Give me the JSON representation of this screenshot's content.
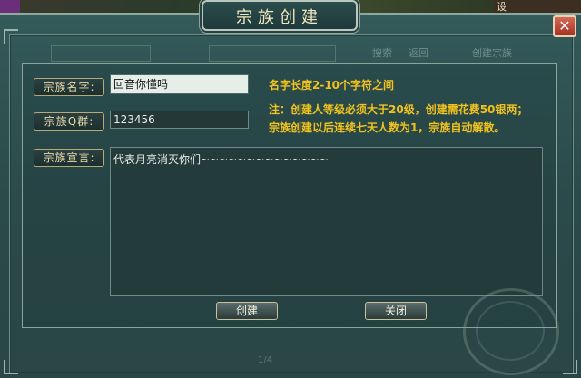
{
  "scene": {
    "top_right_text": "设"
  },
  "dialog": {
    "title": "宗族创建",
    "close_symbol": "✕",
    "ghost_tabs": [
      "",
      "",
      "搜索",
      "返回",
      "创建宗族"
    ],
    "fields": {
      "name_label": "宗族名字:",
      "name_value": "回音你懂吗",
      "qq_label": "宗族Q群:",
      "qq_value": "123456",
      "declaration_label": "宗族宣言:",
      "declaration_value": "代表月亮消灭你们~~~~~~~~~~~~~~"
    },
    "hints": {
      "name_length": "名字长度2-10个字符之间",
      "note_line1": "注：创建人等级必须大于20级，创建需花费50银两；",
      "note_line2": "宗族创建以后连续七天人数为1，宗族自动解散。"
    },
    "buttons": {
      "create": "创建",
      "close": "关闭"
    },
    "footer_page": "1/4"
  },
  "colors": {
    "hint_yellow": "#f2c21d",
    "panel_bg": "#2f4a4a",
    "label_border": "#b8aa78"
  }
}
